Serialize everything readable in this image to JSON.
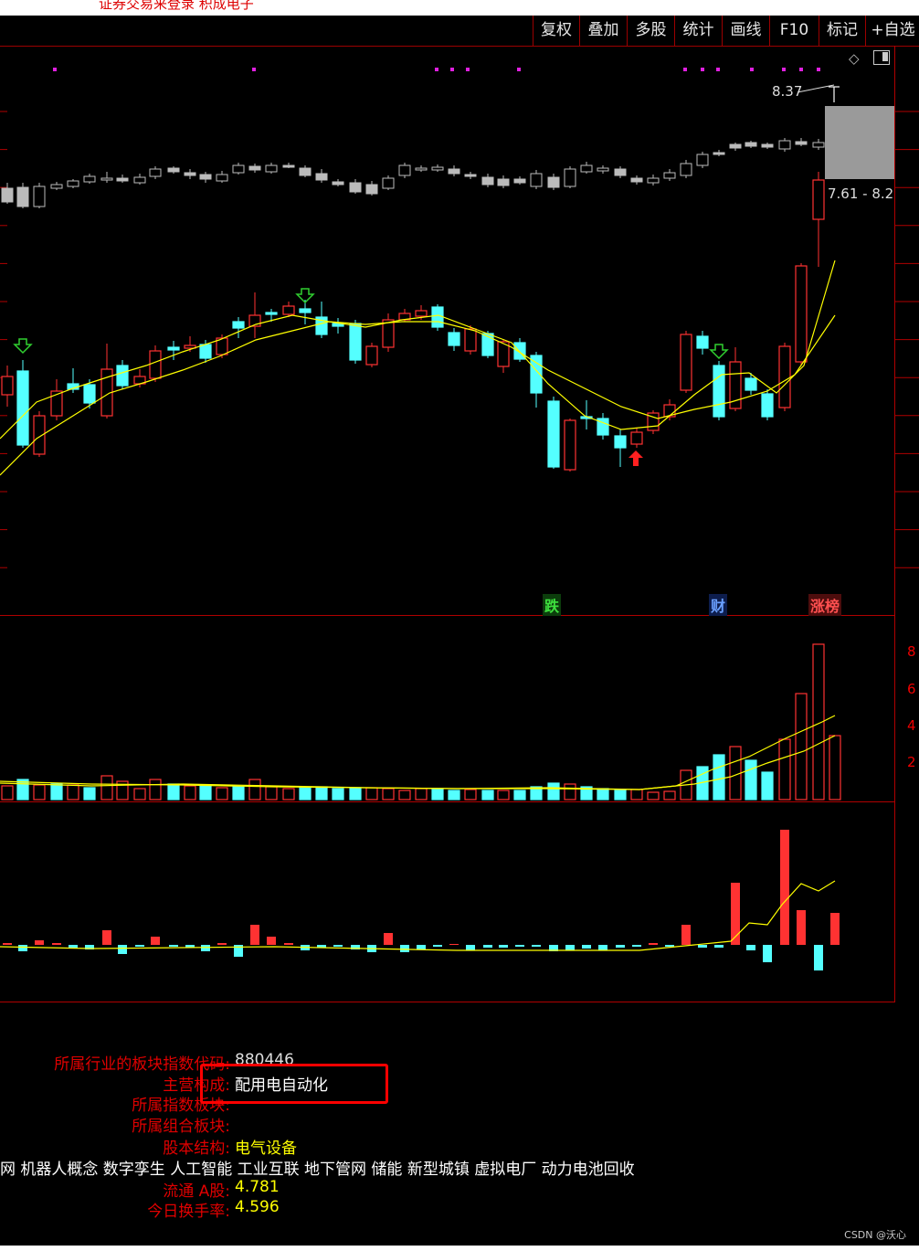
{
  "header": {
    "partial_title": "证券交易来登录 积成电子"
  },
  "toolbar": {
    "buttons": [
      "复权",
      "叠加",
      "多股",
      "统计",
      "画线",
      "F10",
      "标记",
      "+自选"
    ]
  },
  "icons": {
    "diamond": "diamond-icon",
    "window": "window-icon",
    "arrow_up": "up-arrow-icon",
    "arrow_down": "down-arrow-icon"
  },
  "price_panel": {
    "high_label": "8.37",
    "range_label": "7.61 - 8.2",
    "events": [
      "跌",
      "财",
      "涨榜"
    ]
  },
  "volume_panel": {
    "axis_labels": [
      "8",
      "6",
      "4",
      "2"
    ]
  },
  "info": {
    "rows": [
      {
        "label": "所属行业的板块指数代码:",
        "value": "880446"
      },
      {
        "label": "主营构成:",
        "value": "配用电自动化"
      },
      {
        "label": "所属指数板块:",
        "value": ""
      },
      {
        "label": "所属组合板块:",
        "value": ""
      },
      {
        "label": "股本结构:",
        "value": "电气设备"
      }
    ],
    "concepts": "网 机器人概念 数字孪生 人工智能 工业互联 地下管网 储能 新型城镇 虚拟电厂 动力电池回收",
    "rows2": [
      {
        "label": "流通 A股:",
        "value": "4.781"
      },
      {
        "label": "今日换手率:",
        "value": "4.596"
      }
    ]
  },
  "watermark": "CSDN @沃心",
  "colors": {
    "up": "#ff3232",
    "down": "#54ffff",
    "ma": "#ffff00",
    "grid": "#b00000",
    "highlight_box": "#ff0000"
  }
}
